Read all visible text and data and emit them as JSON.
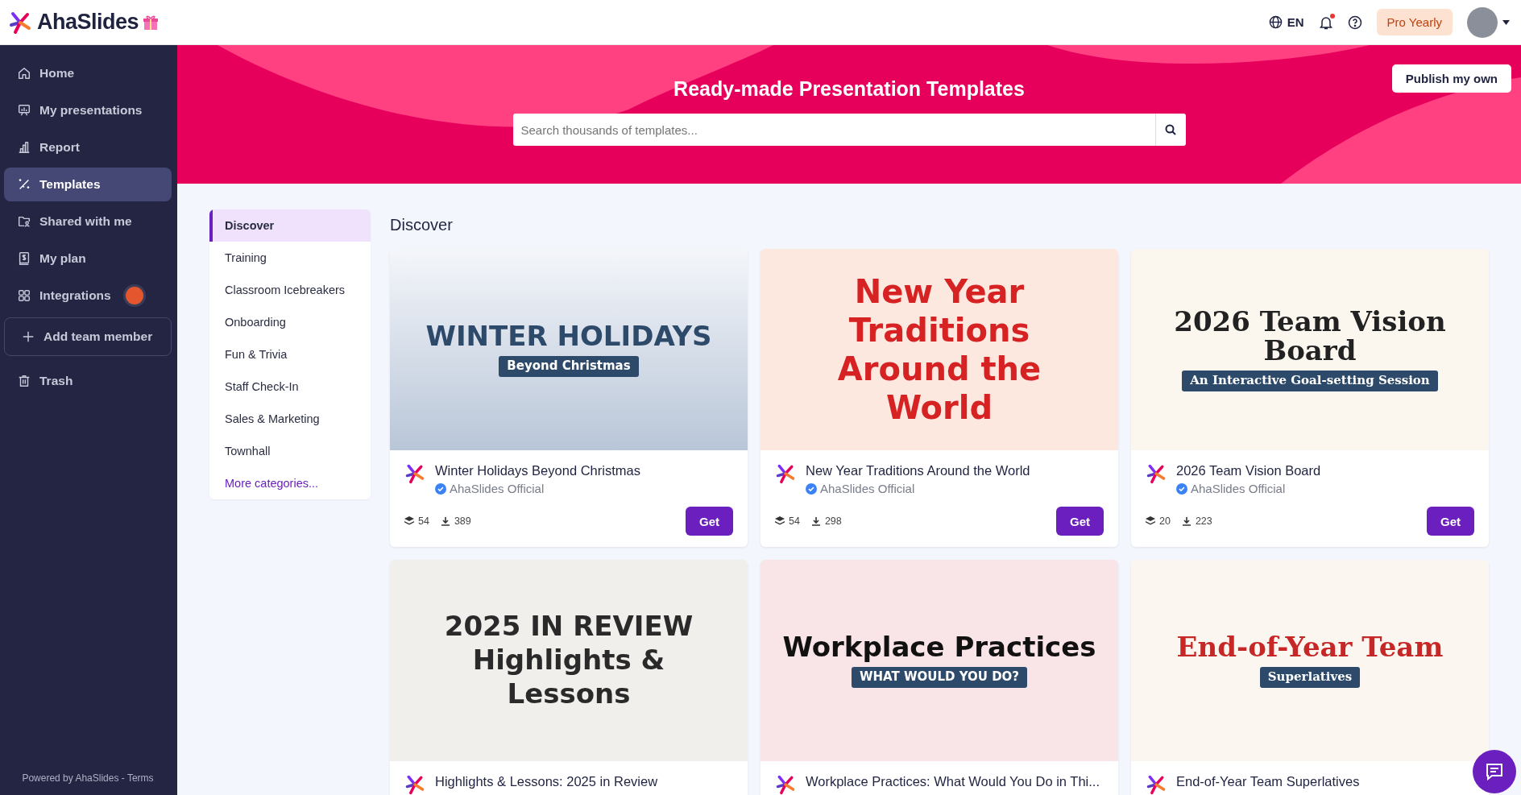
{
  "topbar": {
    "logo": "AhaSlides",
    "language": "EN",
    "notification_unread": true,
    "plan_button": "Pro Yearly"
  },
  "sidebar": {
    "items": [
      {
        "label": "Home",
        "selected": false
      },
      {
        "label": "My presentations",
        "selected": false
      },
      {
        "label": "Report",
        "selected": false
      },
      {
        "label": "Templates",
        "selected": true
      },
      {
        "label": "Shared with me",
        "selected": false
      },
      {
        "label": "My plan",
        "selected": false
      },
      {
        "label": "Integrations",
        "selected": false,
        "badge": true
      },
      {
        "label": "Add team member",
        "selected": false,
        "kind": "outlined"
      },
      {
        "label": "Trash",
        "selected": false
      }
    ],
    "footer": "Powered by AhaSlides - Terms"
  },
  "banner": {
    "title": "Ready-made Presentation Templates",
    "search": {
      "placeholder": "Search thousands of templates..."
    },
    "publish_button": "Publish my own"
  },
  "categories": [
    {
      "label": "Discover",
      "selected": true
    },
    {
      "label": "Training",
      "selected": false
    },
    {
      "label": "Classroom Icebreakers",
      "selected": false
    },
    {
      "label": "Onboarding",
      "selected": false
    },
    {
      "label": "Fun & Trivia",
      "selected": false
    },
    {
      "label": "Staff Check-In",
      "selected": false
    },
    {
      "label": "Sales & Marketing",
      "selected": false
    },
    {
      "label": "Townhall",
      "selected": false
    },
    {
      "label": "More categories...",
      "selected": false,
      "kind": "link"
    }
  ],
  "section_title": "Discover",
  "templates": [
    {
      "title": "Winter Holidays Beyond Christmas",
      "author": "AhaSlides Official",
      "slides": "54",
      "downloads": "389",
      "button": "Get",
      "preview": {
        "lines": [
          "WINTER HOLIDAYS",
          "Beyond Christmas"
        ]
      }
    },
    {
      "title": "New Year Traditions Around the World",
      "author": "AhaSlides Official",
      "slides": "54",
      "downloads": "298",
      "button": "Get",
      "preview": {
        "lines": [
          "New Year",
          "Traditions",
          "Around the",
          "World"
        ]
      }
    },
    {
      "title": "2026 Team Vision Board",
      "author": "AhaSlides Official",
      "slides": "20",
      "downloads": "223",
      "button": "Get",
      "preview": {
        "lines": [
          "2026 Team Vision Board",
          "An Interactive Goal-setting Session"
        ]
      }
    },
    {
      "title": "Highlights & Lessons: 2025 in Review",
      "preview": {
        "lines": [
          "2025 IN REVIEW",
          "Highlights &",
          "Lessons"
        ]
      }
    },
    {
      "title": "Workplace Practices: What Would You Do in Thi...",
      "preview": {
        "lines": [
          "Workplace Practices",
          "WHAT WOULD YOU DO?"
        ]
      }
    },
    {
      "title": "End-of-Year Team Superlatives",
      "preview": {
        "lines": [
          "End-of-Year Team",
          "Superlatives"
        ]
      }
    }
  ]
}
